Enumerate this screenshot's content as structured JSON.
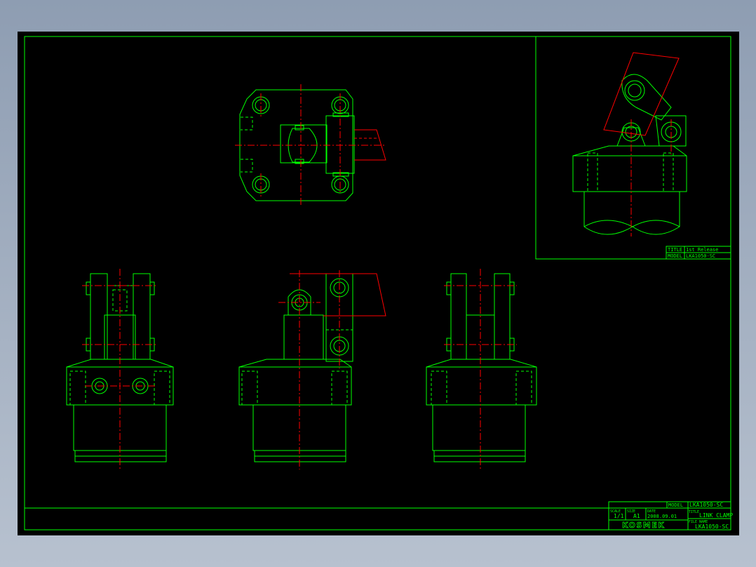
{
  "drawing": {
    "inset_title_block": {
      "title_label": "TITLE",
      "title_value": "1st Release",
      "model_label": "MODEL",
      "model_value": "LKA1050-SC"
    },
    "title_block": {
      "model_label": "MODEL",
      "model_value": "LKA1050-SC",
      "title_label": "TITLE",
      "title_value": "LINK CLAMP",
      "file_name_label": "FILE NAME",
      "file_name_value": "LKA1050-SC",
      "scale_label": "SCALE",
      "scale_value": "1/1",
      "size_label": "SIZE",
      "size_value": "A1",
      "date_label": "DATE",
      "date_value": "2008.09.01",
      "company_logo": "KOSMEK"
    }
  },
  "colors": {
    "background": "#000000",
    "geometry": "#00ff00",
    "centerlines": "#ff0000",
    "viewport": "#8e9db2"
  }
}
